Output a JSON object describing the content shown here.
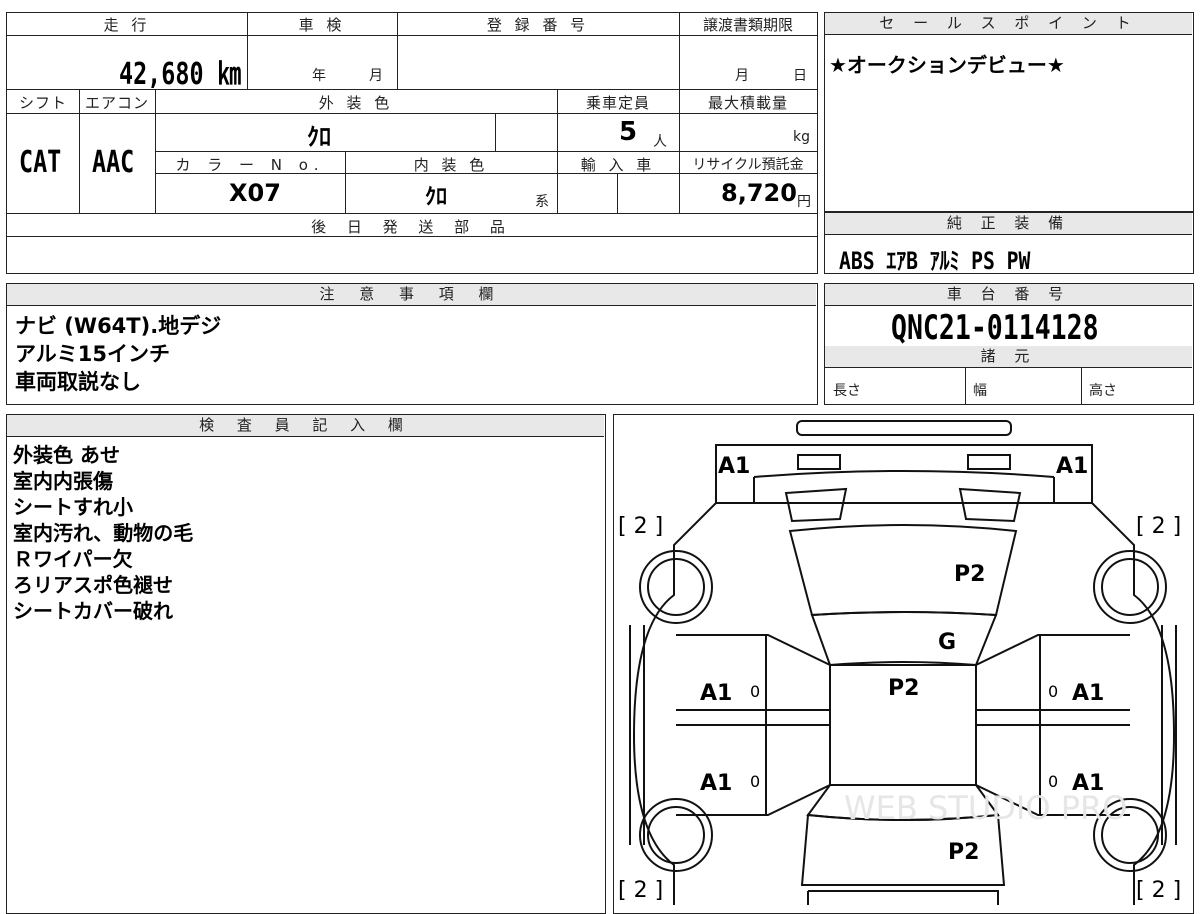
{
  "vehicle": {
    "mileage_label": "走 行",
    "mileage": "42,680 ㎞",
    "inspection_label": "車 検",
    "inspection_year": "年",
    "inspection_month": "月",
    "registration_label": "登 録 番 号",
    "transfer_label": "譲渡書類期限",
    "transfer_month": "月",
    "transfer_day": "日",
    "shift_label": "シフト",
    "shift": "CAT",
    "ac_label": "エアコン",
    "ac": "AAC",
    "exterior_color_label": "外 装 色",
    "exterior_color": "ｸﾛ",
    "capacity_label": "乗車定員",
    "capacity": "5",
    "capacity_unit": "人",
    "max_load_label": "最大積載量",
    "max_load_unit": "kg",
    "color_no_label": "カ ラ ー N o.",
    "color_no": "X07",
    "interior_color_label": "内 装 色",
    "interior_color": "ｸﾛ",
    "interior_color_suffix": "系",
    "import_label": "輸 入 車",
    "recycle_label": "リサイクル預託金",
    "recycle_fee": "8,720",
    "recycle_unit": "円",
    "later_parts_label": "後 日 発 送 部 品"
  },
  "sales": {
    "label": "セ ー ル ス ポ イ ン ト",
    "text": "★オークションデビュー★"
  },
  "equipment": {
    "label": "純 正 装 備",
    "text": "ABS ｴｱB ｱﾙﾐ PS PW"
  },
  "notes": {
    "label": "注 意 事 項 欄",
    "lines": [
      "ナビ (W64T).地デジ",
      "アルミ15インチ",
      "車両取説なし"
    ]
  },
  "chassis": {
    "label": "車 台 番 号",
    "number": "QNC21-0114128",
    "specs_label": "諸 元",
    "length_label": "長さ",
    "width_label": "幅",
    "height_label": "高さ"
  },
  "inspector": {
    "label": "検 査 員 記 入 欄",
    "lines": [
      "外装色 あせ",
      "室内内張傷",
      "シートすれ小",
      "室内汚れ、動物の毛",
      "Ｒワイパー欠",
      "ろリアスポ色褪せ",
      "シートカバー破れ"
    ]
  },
  "diagram": {
    "marks": {
      "front_left": "A1",
      "front_right": "A1",
      "bracket_tl": "[ 2 ]",
      "bracket_tr": "[ 2 ]",
      "bracket_bl": "[ 2 ]",
      "bracket_br": "[ 2 ]",
      "hood": "P2",
      "windshield": "G",
      "roof": "P2",
      "door_fl": "A1",
      "door_fr": "A1",
      "door_rl": "A1",
      "door_rr": "A1",
      "trunk": "P2",
      "zero": "0"
    },
    "watermark": "WEB STUDIO PRO"
  }
}
